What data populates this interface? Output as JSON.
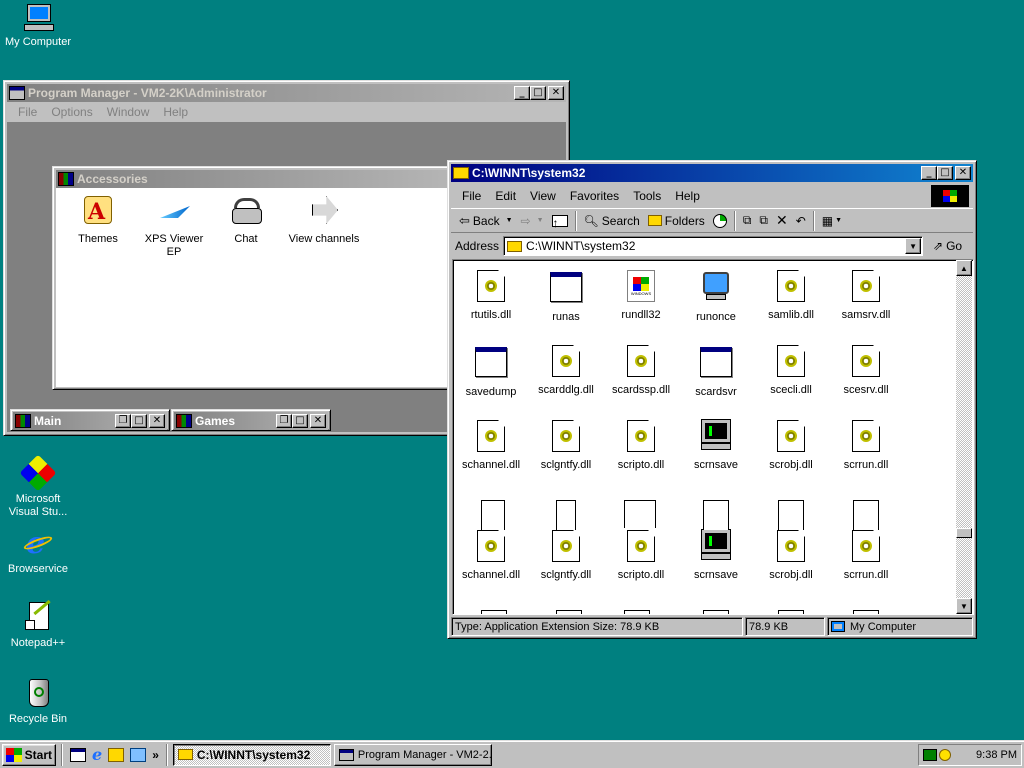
{
  "desktop": {
    "icons": [
      {
        "label": "My Computer",
        "icon": "my-computer-icon"
      },
      {
        "label": "Microsoft Visual Stu...",
        "icon": "visual-studio-icon"
      },
      {
        "label": "Browservice",
        "icon": "internet-explorer-icon"
      },
      {
        "label": "Notepad++",
        "icon": "notepadpp-icon"
      },
      {
        "label": "Recycle Bin",
        "icon": "recycle-bin-icon"
      }
    ]
  },
  "program_manager": {
    "title": "Program Manager - VM2-2K\\Administrator",
    "menu": [
      "File",
      "Options",
      "Window",
      "Help"
    ],
    "accessories": {
      "title": "Accessories",
      "items": [
        {
          "label": "Themes",
          "icon": "themes-icon"
        },
        {
          "label": "XPS Viewer EP",
          "icon": "xps-viewer-icon"
        },
        {
          "label": "Chat",
          "icon": "chat-phone-icon"
        },
        {
          "label": "View channels",
          "icon": "view-channels-arrow-icon"
        }
      ]
    },
    "minimized": [
      {
        "title": "Main"
      },
      {
        "title": "Games"
      }
    ]
  },
  "explorer": {
    "title": "C:\\WINNT\\system32",
    "menu": [
      "File",
      "Edit",
      "View",
      "Favorites",
      "Tools",
      "Help"
    ],
    "toolbar": {
      "back": "Back",
      "search": "Search",
      "folders": "Folders"
    },
    "address": {
      "label": "Address",
      "value": "C:\\WINNT\\system32",
      "go": "Go"
    },
    "files_row1": [
      {
        "name": "rtutils.dll",
        "type": "dll"
      },
      {
        "name": "runas",
        "type": "exe"
      },
      {
        "name": "rundll32",
        "type": "windows"
      },
      {
        "name": "runonce",
        "type": "runonce"
      },
      {
        "name": "samlib.dll",
        "type": "dll"
      },
      {
        "name": "samsrv.dll",
        "type": "dll"
      }
    ],
    "files_row2": [
      {
        "name": "savedump",
        "type": "exe"
      },
      {
        "name": "scarddlg.dll",
        "type": "dll"
      },
      {
        "name": "scardssp.dll",
        "type": "dll"
      },
      {
        "name": "scardsvr",
        "type": "exe"
      },
      {
        "name": "scecli.dll",
        "type": "dll"
      },
      {
        "name": "scesrv.dll",
        "type": "dll"
      }
    ],
    "files_row3": [
      {
        "name": "schannel.dll",
        "type": "dll"
      },
      {
        "name": "sclgntfy.dll",
        "type": "dll"
      },
      {
        "name": "scripto.dll",
        "type": "dll"
      },
      {
        "name": "scrnsave",
        "type": "monitor"
      },
      {
        "name": "scrobj.dll",
        "type": "dll"
      },
      {
        "name": "scrrun.dll",
        "type": "dll"
      }
    ],
    "files_row4": [
      {
        "name": "schannel.dll",
        "type": "dll"
      },
      {
        "name": "sclgntfy.dll",
        "type": "dll"
      },
      {
        "name": "scripto.dll",
        "type": "dll"
      },
      {
        "name": "scrnsave",
        "type": "monitor"
      },
      {
        "name": "scrobj.dll",
        "type": "dll"
      },
      {
        "name": "scrrun.dll",
        "type": "dll"
      }
    ],
    "status": {
      "info": "Type: Application Extension Size: 78.9 KB",
      "size": "78.9 KB",
      "zone": "My Computer"
    }
  },
  "taskbar": {
    "start": "Start",
    "quicklaunch_more": "»",
    "tasks": [
      {
        "label": "C:\\WINNT\\system32",
        "active": true
      },
      {
        "label": "Program Manager - VM2-2...",
        "active": false
      }
    ],
    "clock": "9:38 PM"
  },
  "colors": {
    "desktop": "#008080",
    "title_active": "#000080",
    "title_inactive": "#808080",
    "face": "#c0c0c0"
  }
}
